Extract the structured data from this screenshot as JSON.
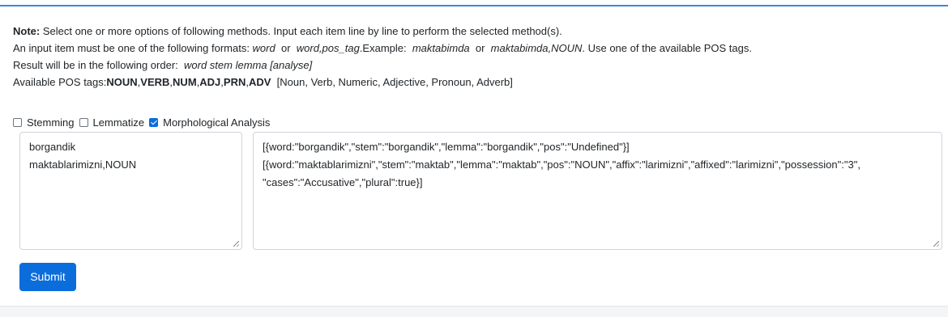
{
  "note": {
    "label": "Note:",
    "line1": " Select one or more options of following methods. Input each item line by line to perform the selected method(s).",
    "line2_prefix": "An input item must be one of the following formats: ",
    "format_word": "word",
    "or1": "  or  ",
    "format_word_pos": "word,pos_tag",
    "example_label": ".Example:  ",
    "example1": "maktabimda",
    "or2": "  or  ",
    "example2": "maktabimda,NOUN",
    "line2_suffix": ". Use one of the available POS tags.",
    "line3_prefix": "Result will be in the following order:  ",
    "line3_order": "word stem lemma [analyse]",
    "line4_prefix": "Available POS tags:",
    "pos_tags": [
      "NOUN",
      "VERB",
      "NUM",
      "ADJ",
      "PRN",
      "ADV"
    ],
    "pos_desc": "  [Noun, Verb, Numeric, Adjective, Pronoun, Adverb]"
  },
  "methods": [
    {
      "label": "Stemming",
      "checked": false
    },
    {
      "label": "Lemmatize",
      "checked": false
    },
    {
      "label": "Morphological Analysis",
      "checked": true
    }
  ],
  "input": {
    "lines": [
      "borgandik",
      "maktablarimizni,NOUN"
    ]
  },
  "output": {
    "lines": [
      "[{word:\"borgandik\",\"stem\":\"borgandik\",\"lemma\":\"borgandik\",\"pos\":\"Undefined\"}]",
      "[{word:\"maktablarimizni\",\"stem\":\"maktab\",\"lemma\":\"maktab\",\"pos\":\"NOUN\",\"affix\":\"larimizni\",\"affixed\":\"larimizni\",\"possession\":\"3\",",
      "\"cases\":\"Accusative\",\"plural\":true}]"
    ]
  },
  "submit_label": "Submit",
  "colors": {
    "accent": "#0b6ddb",
    "top_rule": "#3b86d8",
    "border": "#ced4da"
  }
}
